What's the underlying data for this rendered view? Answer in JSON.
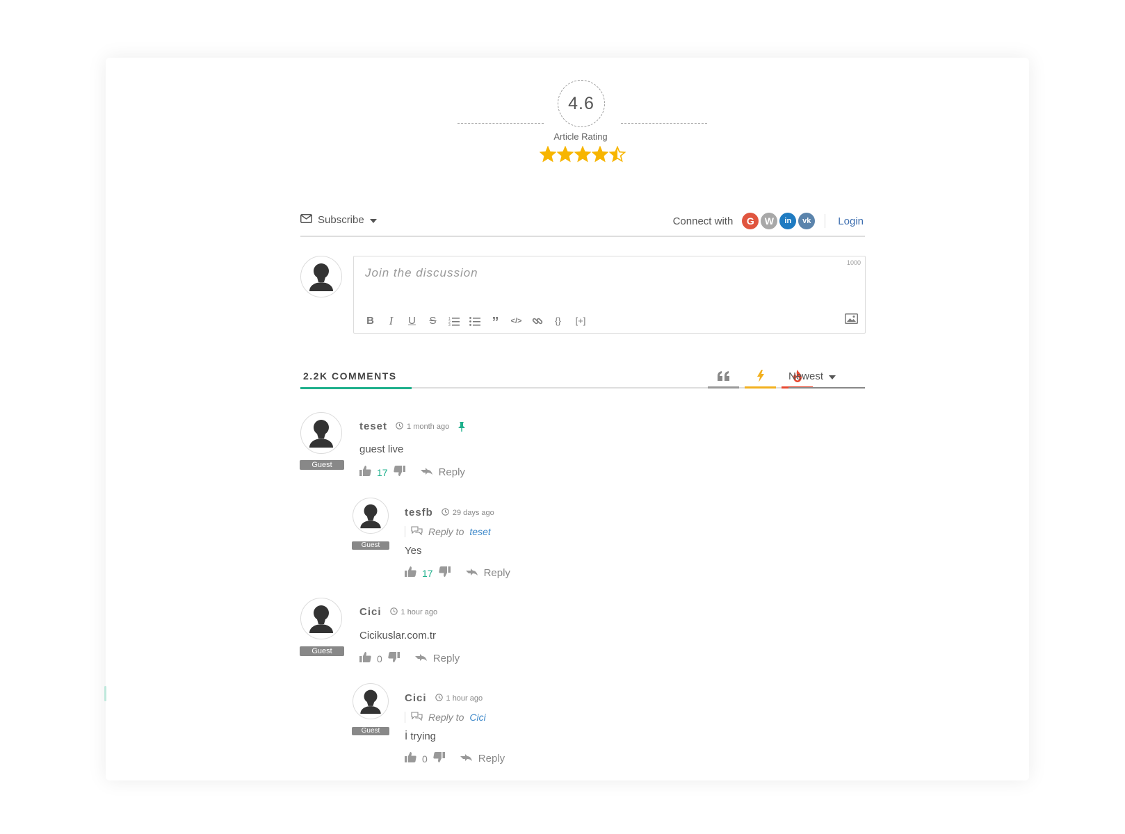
{
  "rating": {
    "value": "4.6",
    "label": "Article Rating",
    "stars": 4.5,
    "star_color": "#f7b500"
  },
  "subscribe": {
    "label": "Subscribe"
  },
  "connect": {
    "label": "Connect with",
    "networks": [
      {
        "name": "google",
        "glyph": "G",
        "color": "#e0553f"
      },
      {
        "name": "wordpress",
        "glyph": "W",
        "color": "#a8a8a8"
      },
      {
        "name": "linkedin",
        "glyph": "in",
        "color": "#1f7bc1"
      },
      {
        "name": "vk",
        "glyph": "vk",
        "color": "#5b84ac"
      }
    ],
    "login": "Login"
  },
  "editor": {
    "placeholder": "Join the discussion",
    "counter": "1000",
    "toolbar": [
      "bold-icon",
      "italic-icon",
      "underline-icon",
      "strikethrough-icon",
      "ordered-list-icon",
      "bullet-list-icon",
      "quote-icon",
      "code-icon",
      "link-icon",
      "code-block-icon",
      "spoiler-icon"
    ]
  },
  "comments": {
    "title": "2.2K COMMENTS",
    "filters": [
      {
        "name": "inline-feedback",
        "color": "#999999"
      },
      {
        "name": "most-reacted",
        "color": "#f2b01e"
      },
      {
        "name": "hottest",
        "color": "#e8472f"
      }
    ],
    "sort": "Newest",
    "accent": "#1eb08c",
    "items": [
      {
        "author": "teset",
        "time": "1 month ago",
        "text": "guest live",
        "likes": "17",
        "reply": "Reply",
        "badge": "Guest",
        "pinned": true
      },
      {
        "author": "tesfb",
        "time": "29 days ago",
        "reply_to_label": "Reply to",
        "reply_to": "teset",
        "text": "Yes",
        "likes": "17",
        "reply": "Reply",
        "badge": "Guest"
      },
      {
        "author": "Cici",
        "time": "1 hour ago",
        "text": "Cicikuslar.com.tr",
        "likes": "0",
        "reply": "Reply",
        "badge": "Guest"
      },
      {
        "author": "Cici",
        "time": "1 hour ago",
        "reply_to_label": "Reply to",
        "reply_to": "Cici",
        "text": "İ trying",
        "likes": "0",
        "reply": "Reply",
        "badge": "Guest"
      }
    ]
  }
}
